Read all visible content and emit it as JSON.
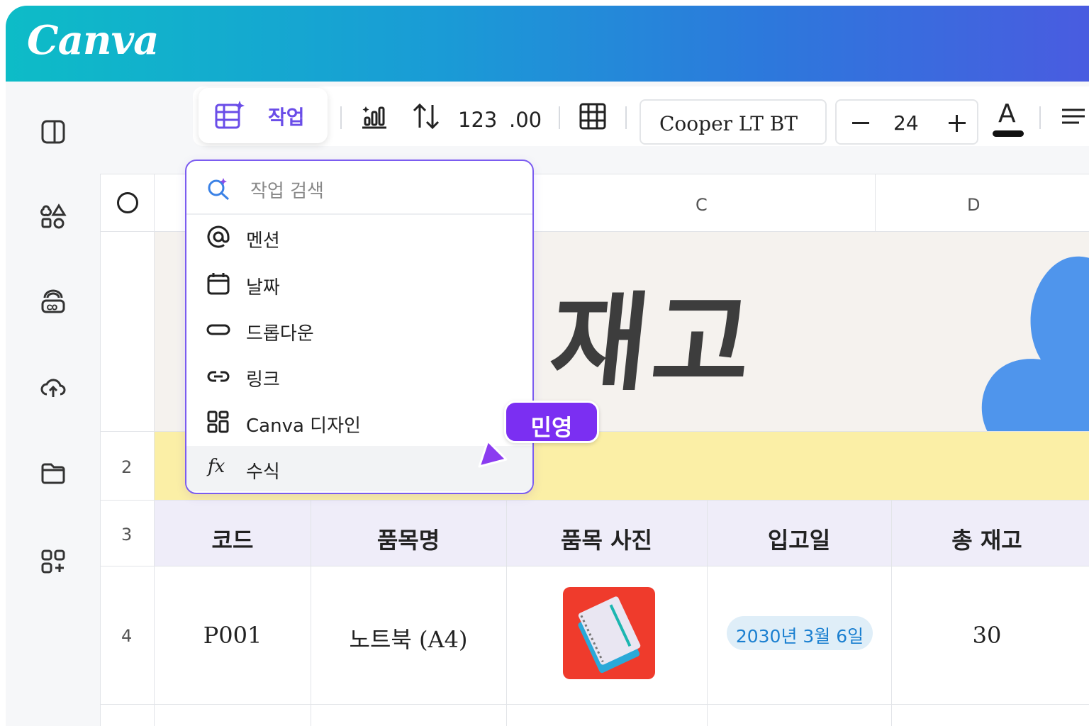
{
  "app": {
    "logo": "Canva"
  },
  "toolbar": {
    "task_label": "작업",
    "number_format": "123",
    "decimal_format": ".00",
    "font_name": "Cooper LT BT",
    "font_size": "24",
    "text_color_letter": "A"
  },
  "dropdown": {
    "search_placeholder": "작업 검색",
    "items": [
      {
        "label": "멘션",
        "icon": "at-sign-icon"
      },
      {
        "label": "날짜",
        "icon": "calendar-icon"
      },
      {
        "label": "드롭다운",
        "icon": "dropdown-pill-icon"
      },
      {
        "label": "링크",
        "icon": "link-icon"
      },
      {
        "label": "Canva 디자인",
        "icon": "grid-design-icon"
      },
      {
        "label": "수식",
        "icon": "fx",
        "active": true
      }
    ],
    "fx_glyph": "fx"
  },
  "collaborator": {
    "name": "민영",
    "color": "#7b2ff2"
  },
  "sheet": {
    "columns": [
      "C",
      "D"
    ],
    "rows": [
      "2",
      "3",
      "4"
    ],
    "banner_title": "재고",
    "headers": [
      "코드",
      "품목명",
      "품목 사진",
      "입고일",
      "총 재고"
    ],
    "row4": {
      "code": "P001",
      "name": "노트북 (A4)",
      "photo": "notebook-photo",
      "date": "2030년 3월 6일",
      "stock": "30"
    }
  },
  "colors": {
    "accent": "#7b5cf0",
    "header_gradient_start": "#0dbcc7",
    "header_gradient_end": "#4a5be0",
    "banner_bg": "#f5f2ee",
    "yellow_row": "#fbefa6",
    "header_row": "#efedf9",
    "date_chip": "#dfeef8"
  }
}
